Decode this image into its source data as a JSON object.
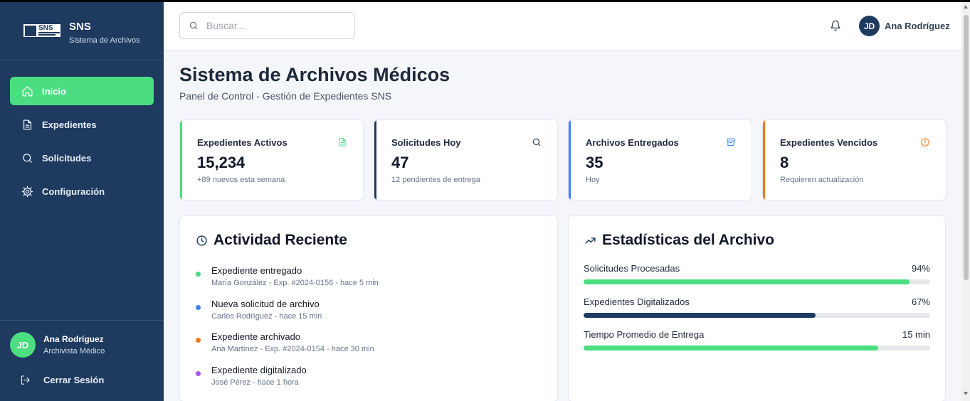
{
  "brand": {
    "name": "SNS",
    "subtitle": "Sistema de Archivos",
    "logo_text": "SNS"
  },
  "sidebar": {
    "items": [
      {
        "label": "Inicio",
        "icon": "home-icon",
        "active": true
      },
      {
        "label": "Expedientes",
        "icon": "file-icon",
        "active": false
      },
      {
        "label": "Solicitudes",
        "icon": "search-icon",
        "active": false
      },
      {
        "label": "Configuración",
        "icon": "gear-icon",
        "active": false
      }
    ],
    "user": {
      "initials": "JD",
      "name": "Ana Rodríguez",
      "role": "Archivista Médico"
    },
    "logout_label": "Cerrar Sesión"
  },
  "header": {
    "search_placeholder": "Buscar...",
    "user_initials": "JD",
    "user_name": "Ana Rodríguez"
  },
  "page": {
    "title": "Sistema de Archivos Médicos",
    "subtitle": "Panel de Control - Gestión de Expedientes SNS"
  },
  "stats": [
    {
      "label": "Expedientes Activos",
      "value": "15,234",
      "note": "+89 nuevos esta semana",
      "icon": "document-icon",
      "color": "#4ade80"
    },
    {
      "label": "Solicitudes Hoy",
      "value": "47",
      "note": "12 pendientes de entrega",
      "icon": "search-icon",
      "color": "#1e3a5f"
    },
    {
      "label": "Archivos Entregados",
      "value": "35",
      "note": "Hoy",
      "icon": "archive-icon",
      "color": "#3b82f6"
    },
    {
      "label": "Expedientes Vencidos",
      "value": "8",
      "note": "Requieren actualización",
      "icon": "alert-icon",
      "color": "#f97316"
    }
  ],
  "activity": {
    "title": "Actividad Reciente",
    "items": [
      {
        "title": "Expediente entregado",
        "meta": "María González - Exp. #2024-0156 - hace 5 min",
        "color": "#4ade80"
      },
      {
        "title": "Nueva solicitud de archivo",
        "meta": "Carlos Rodríguez - hace 15 min",
        "color": "#3b82f6"
      },
      {
        "title": "Expediente archivado",
        "meta": "Ana Martínez - Exp. #2024-0154 - hace 30 min",
        "color": "#f97316"
      },
      {
        "title": "Expediente digitalizado",
        "meta": "José Pérez - hace 1 hora",
        "color": "#a855f7"
      }
    ]
  },
  "archive_stats": {
    "title": "Estadísticas del Archivo",
    "rows": [
      {
        "label": "Solicitudes Procesadas",
        "value": "94%",
        "fill_fraction": 0.94,
        "color": "#4ade80"
      },
      {
        "label": "Expedientes Digitalizados",
        "value": "67%",
        "fill_fraction": 0.67,
        "color": "#1e3a5f"
      },
      {
        "label": "Tiempo Promedio de Entrega",
        "value": "15 min",
        "fill_fraction": 0.85,
        "color": "#4ade80"
      }
    ]
  }
}
